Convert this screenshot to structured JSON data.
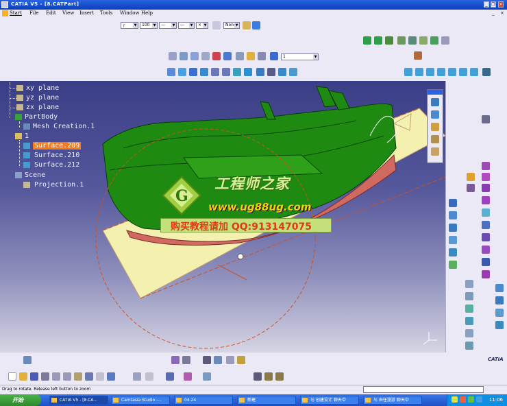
{
  "window": {
    "title": "CATIA V5 - [8.CATPart]",
    "minimize": "_",
    "restore": "❐",
    "close": "×"
  },
  "menu": [
    "Start",
    "File",
    "Edit",
    "View",
    "Insert",
    "Tools",
    "Window",
    "Help"
  ],
  "menu_right": [
    "_",
    "×"
  ],
  "toolbar": {
    "line_weight": "100",
    "layer": "None",
    "current_layer": "1"
  },
  "tree": {
    "items": [
      "xy plane",
      "yz plane",
      "zx plane",
      "PartBody",
      "Mesh Creation.1",
      "1",
      "Surface.209",
      "Surface.210",
      "Surface.212",
      "Scene",
      "Projection.1"
    ],
    "selected": "Surface.209"
  },
  "watermark": {
    "line1": "工程师之家",
    "line2": "www.ug88ug.com",
    "line3": "购买教程请加 QQ:913147075"
  },
  "status": {
    "message": "Drag to rotate. Release left button to zoom"
  },
  "logo": "CATIA",
  "taskbar": {
    "start": "开始",
    "tasks": [
      "CATIA V5 - [8.CA...",
      "Camtasia Studio -...",
      "04.24",
      "新建",
      "与 创建设计 聊天中",
      "与 由任漫游 聊天中"
    ],
    "clock": "11:06"
  },
  "colors": {
    "title_blue": "#0a3fb8",
    "viewport_top": "#3a3e86",
    "model_green": "#1f8a12",
    "selection_orange": "#f47a1f",
    "plane_yellow": "#f3f0b0"
  }
}
